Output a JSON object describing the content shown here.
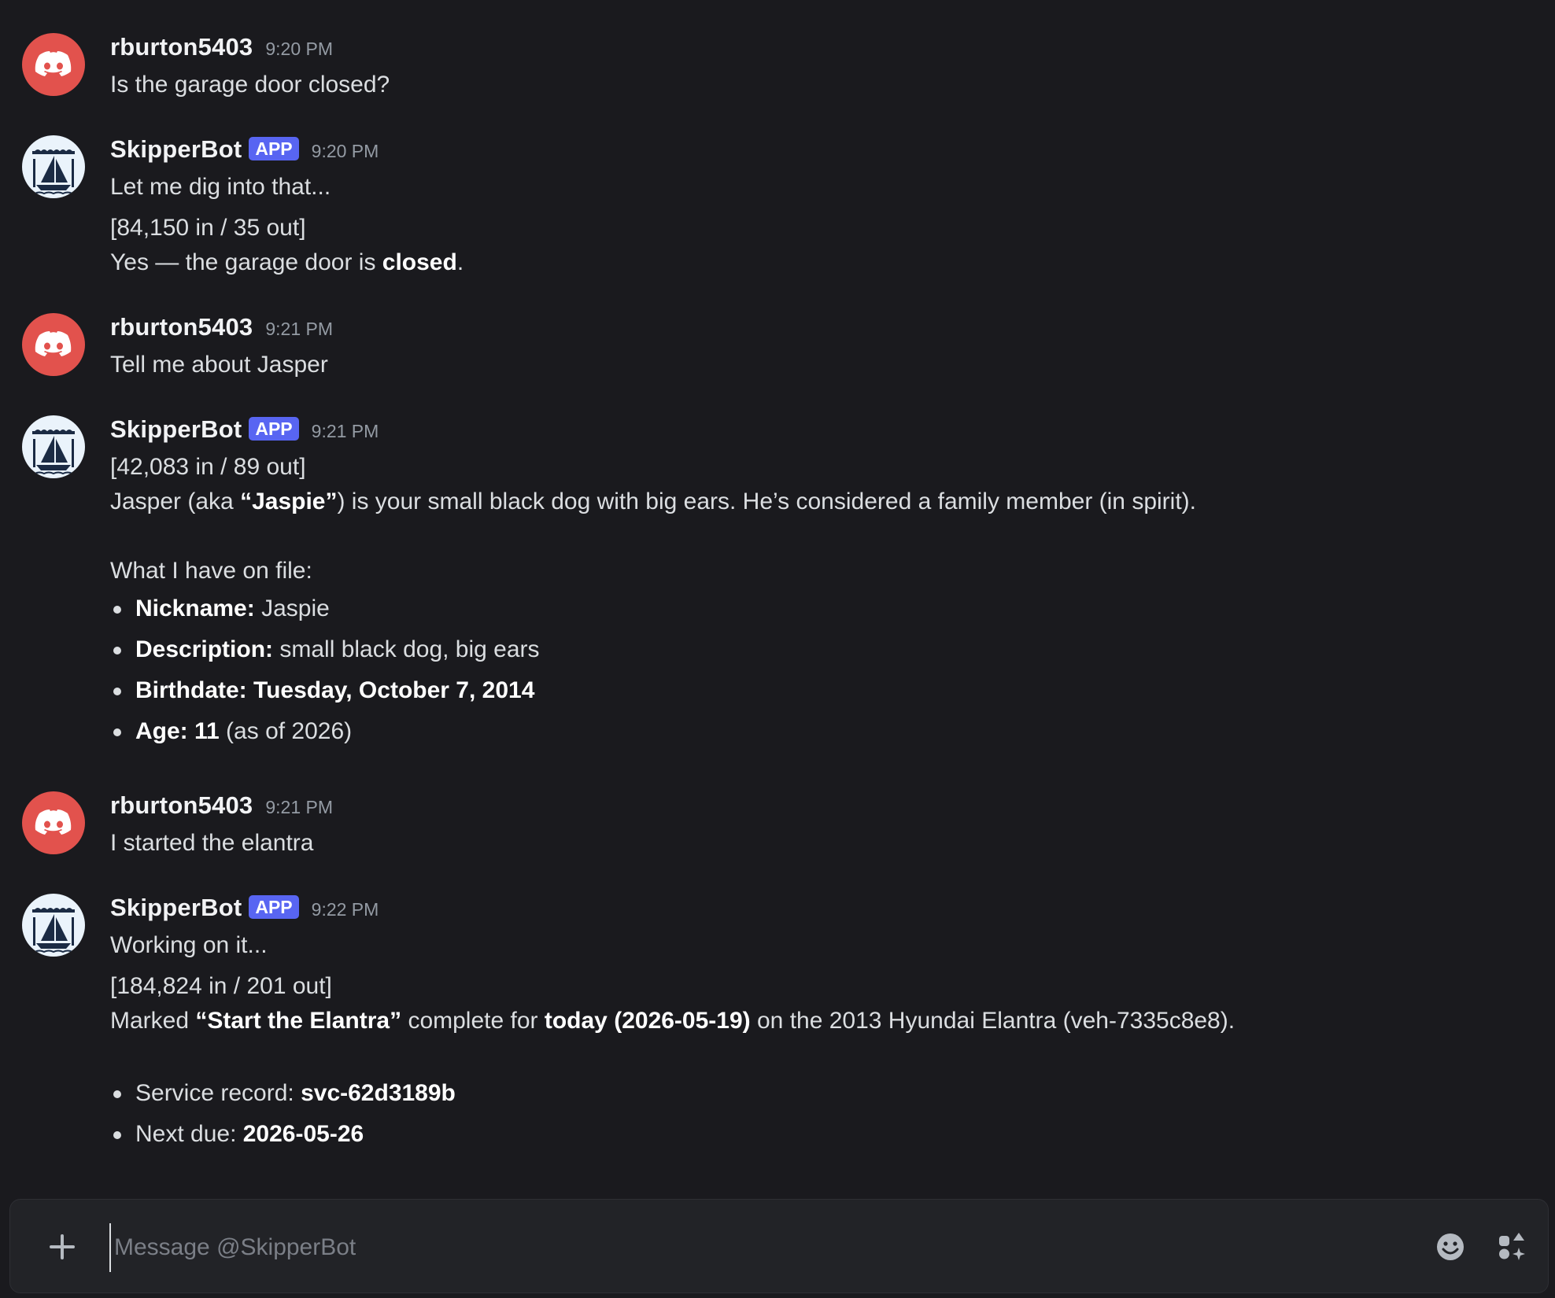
{
  "composer": {
    "placeholder": "Message @SkipperBot"
  },
  "messages": [
    {
      "author": "rburton5403",
      "time": "9:20 PM",
      "text": "Is the garage door closed?"
    },
    {
      "author": "SkipperBot",
      "badge": "APP",
      "time": "9:20 PM",
      "line1": "Let me dig into that...",
      "tokens": "[84,150 in / 35 out]",
      "answer_pre": "Yes — the garage door is ",
      "answer_bold": "closed",
      "answer_post": "."
    },
    {
      "author": "rburton5403",
      "time": "9:21 PM",
      "text": "Tell me about Jasper"
    },
    {
      "author": "SkipperBot",
      "badge": "APP",
      "time": "9:21 PM",
      "tokens": "[42,083 in / 89 out]",
      "desc_pre": "Jasper (aka ",
      "desc_bold": "“Jaspie”",
      "desc_post": ") is your small black dog with big ears. He’s considered a family member (in spirit).",
      "file_heading": "What I have on file:",
      "facts": [
        {
          "label": "Nickname:",
          "value": " Jaspie"
        },
        {
          "label": "Description:",
          "value": " small black dog, big ears"
        },
        {
          "label": "Birthdate: Tuesday, October 7, 2014",
          "value": ""
        },
        {
          "label": "Age: 11",
          "value": " (as of 2026)"
        }
      ]
    },
    {
      "author": "rburton5403",
      "time": "9:21 PM",
      "text": "I started the elantra"
    },
    {
      "author": "SkipperBot",
      "badge": "APP",
      "time": "9:22 PM",
      "line1": "Working on it...",
      "tokens": "[184,824 in / 201 out]",
      "m1": "Marked ",
      "m2": "“Start the Elantra”",
      "m3": " complete for ",
      "m4": "today (2026-05-19)",
      "m5": " on the 2013 Hyundai Elantra (veh-7335c8e8).",
      "details": [
        {
          "label": "Service record: ",
          "value": "svc-62d3189b"
        },
        {
          "label": "Next due: ",
          "value": "2026-05-26"
        }
      ]
    }
  ],
  "icons": {
    "user_avatar": "discord-logo-icon",
    "bot_avatar": "sailboat-logo-icon",
    "composer_left": "plus-icon",
    "composer_emoji": "smiley-icon",
    "composer_apps": "apps-icon"
  },
  "colors": {
    "background": "#1a1a1e",
    "user_avatar": "#e2524d",
    "app_badge": "#5865f2"
  }
}
